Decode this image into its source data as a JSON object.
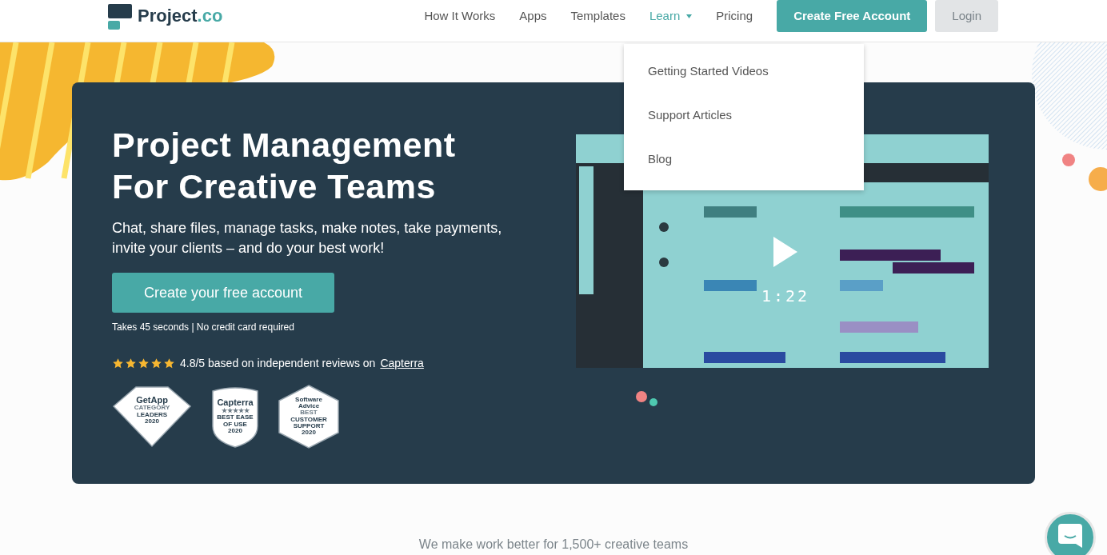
{
  "logo": {
    "name": "Project",
    "suffix": ".co"
  },
  "nav": [
    {
      "label": "How It Works",
      "selected": false,
      "has_menu": false
    },
    {
      "label": "Apps",
      "selected": false,
      "has_menu": false
    },
    {
      "label": "Templates",
      "selected": false,
      "has_menu": false
    },
    {
      "label": "Learn",
      "selected": true,
      "has_menu": true
    },
    {
      "label": "Pricing",
      "selected": false,
      "has_menu": false
    }
  ],
  "header_buttons": [
    {
      "label": "Create Free Account",
      "kind": "primary"
    },
    {
      "label": "Login",
      "kind": "secondary"
    }
  ],
  "dropdown": {
    "items": [
      "Getting Started Videos",
      "Support Articles",
      "Blog"
    ]
  },
  "hero": {
    "title_lines": [
      "Project Management",
      "For Creative Teams"
    ],
    "subtitle": "Chat, share files, manage tasks, make notes, take payments, invite your clients – and do your best work!",
    "cta": "Create your free account",
    "note": "Takes 45 seconds | No credit card required",
    "stars": 5,
    "rating_text": "4.8/5 based on independent reviews on",
    "rating_link": "Capterra",
    "badges": [
      {
        "kind": "diamond",
        "brand": "GetApp",
        "lines": [
          "CATEGORY",
          "LEADERS",
          "2020"
        ]
      },
      {
        "kind": "shield",
        "brand": "Capterra",
        "lines": [
          "★★★★★",
          "BEST EASE",
          "OF USE",
          "2020"
        ]
      },
      {
        "kind": "hexagon",
        "brand": "Software Advice",
        "lines": [
          "BEST",
          "CUSTOMER",
          "SUPPORT",
          "2020"
        ]
      }
    ],
    "video": {
      "kind": "picture",
      "duration": "1:22"
    }
  },
  "tagline": "We make work better for 1,500+ creative teams"
}
